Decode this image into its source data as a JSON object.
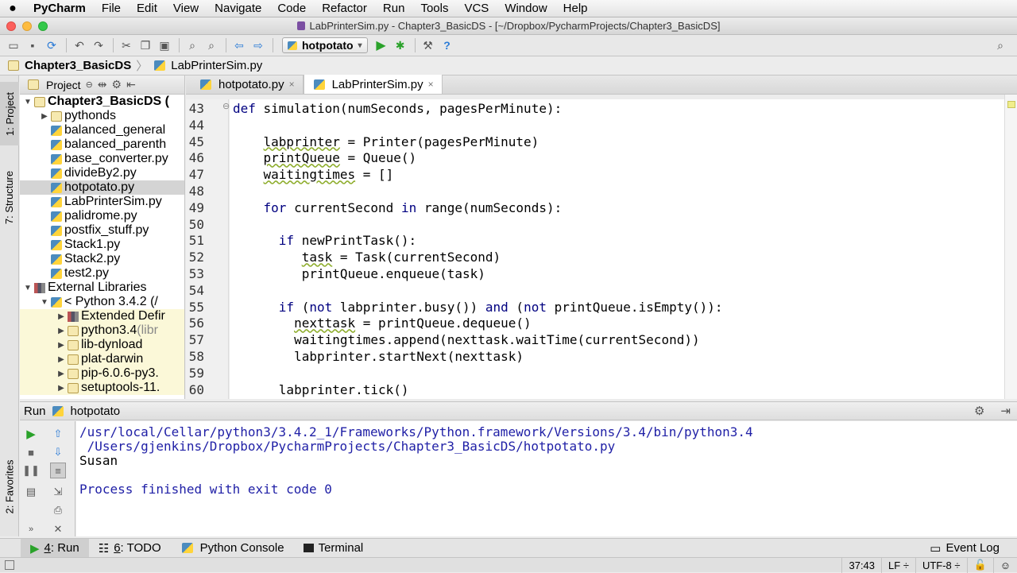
{
  "menubar": {
    "items": [
      "PyCharm",
      "File",
      "Edit",
      "View",
      "Navigate",
      "Code",
      "Refactor",
      "Run",
      "Tools",
      "VCS",
      "Window",
      "Help"
    ]
  },
  "window": {
    "title": "LabPrinterSim.py - Chapter3_BasicDS - [~/Dropbox/PycharmProjects/Chapter3_BasicDS]"
  },
  "toolbar": {
    "run_config": "hotpotato"
  },
  "breadcrumb": [
    "Chapter3_BasicDS",
    "LabPrinterSim.py"
  ],
  "leftstrip": {
    "project_tab": "1: Project",
    "structure_tab": "7: Structure",
    "favorites_tab": "2: Favorites"
  },
  "project": {
    "header": "Project",
    "tree": [
      {
        "label": "Chapter3_BasicDS (",
        "indent": 0,
        "tri": "▼",
        "icon": "folder",
        "bold": true
      },
      {
        "label": "pythonds",
        "indent": 1,
        "tri": "▶",
        "icon": "folder"
      },
      {
        "label": "balanced_general",
        "indent": 1,
        "tri": "",
        "icon": "py"
      },
      {
        "label": "balanced_parenth",
        "indent": 1,
        "tri": "",
        "icon": "py"
      },
      {
        "label": "base_converter.py",
        "indent": 1,
        "tri": "",
        "icon": "py"
      },
      {
        "label": "divideBy2.py",
        "indent": 1,
        "tri": "",
        "icon": "py"
      },
      {
        "label": "hotpotato.py",
        "indent": 1,
        "tri": "",
        "icon": "py",
        "selected": true
      },
      {
        "label": "LabPrinterSim.py",
        "indent": 1,
        "tri": "",
        "icon": "py"
      },
      {
        "label": "palidrome.py",
        "indent": 1,
        "tri": "",
        "icon": "py"
      },
      {
        "label": "postfix_stuff.py",
        "indent": 1,
        "tri": "",
        "icon": "py"
      },
      {
        "label": "Stack1.py",
        "indent": 1,
        "tri": "",
        "icon": "py"
      },
      {
        "label": "Stack2.py",
        "indent": 1,
        "tri": "",
        "icon": "py"
      },
      {
        "label": "test2.py",
        "indent": 1,
        "tri": "",
        "icon": "py"
      },
      {
        "label": "External Libraries",
        "indent": 0,
        "tri": "▼",
        "icon": "lib"
      },
      {
        "label": "< Python 3.4.2 (/",
        "indent": 1,
        "tri": "▼",
        "icon": "py"
      },
      {
        "label": "Extended Defir",
        "indent": 2,
        "tri": "▶",
        "icon": "lib",
        "ext": true
      },
      {
        "label": "python3.4",
        "suffix": " (libr",
        "indent": 2,
        "tri": "▶",
        "icon": "folder",
        "ext": true
      },
      {
        "label": "lib-dynload",
        "indent": 2,
        "tri": "▶",
        "icon": "folder",
        "ext": true
      },
      {
        "label": "plat-darwin",
        "indent": 2,
        "tri": "▶",
        "icon": "folder",
        "ext": true
      },
      {
        "label": "pip-6.0.6-py3.",
        "indent": 2,
        "tri": "▶",
        "icon": "folder",
        "ext": true
      },
      {
        "label": "setuptools-11.",
        "indent": 2,
        "tri": "▶",
        "icon": "folder",
        "ext": true
      }
    ]
  },
  "editor": {
    "tabs": [
      {
        "label": "hotpotato.py",
        "active": false
      },
      {
        "label": "LabPrinterSim.py",
        "active": true
      }
    ],
    "lines": [
      {
        "n": "43",
        "html": "<span class=\"kw\">def</span> simulation(numSeconds, pagesPerMinute):"
      },
      {
        "n": "44",
        "html": ""
      },
      {
        "n": "45",
        "html": "    <span class=\"sq\">labprinter</span> = Printer(pagesPerMinute)"
      },
      {
        "n": "46",
        "html": "    <span class=\"sq\">printQueue</span> = Queue()"
      },
      {
        "n": "47",
        "html": "    <span class=\"sq\">waitingtimes</span> = []"
      },
      {
        "n": "48",
        "html": ""
      },
      {
        "n": "49",
        "html": "    <span class=\"kw\">for</span> currentSecond <span class=\"kw\">in</span> range(numSeconds):"
      },
      {
        "n": "50",
        "html": ""
      },
      {
        "n": "51",
        "html": "      <span class=\"kw\">if</span> newPrintTask():"
      },
      {
        "n": "52",
        "html": "         <span class=\"sq\">task</span> = Task(currentSecond)"
      },
      {
        "n": "53",
        "html": "         printQueue.enqueue(task)"
      },
      {
        "n": "54",
        "html": ""
      },
      {
        "n": "55",
        "html": "      <span class=\"kw\">if</span> (<span class=\"kw\">not</span> labprinter.busy()) <span class=\"kw\">and</span> (<span class=\"kw\">not</span> printQueue.isEmpty()):"
      },
      {
        "n": "56",
        "html": "        <span class=\"sq\">nexttask</span> = printQueue.dequeue()"
      },
      {
        "n": "57",
        "html": "        waitingtimes.append(nexttask.waitTime(currentSecond))"
      },
      {
        "n": "58",
        "html": "        labprinter.startNext(nexttask)"
      },
      {
        "n": "59",
        "html": ""
      },
      {
        "n": "60",
        "html": "      labprinter.tick()"
      }
    ]
  },
  "run": {
    "label": "Run",
    "config": "hotpotato",
    "output": [
      {
        "text": "/usr/local/Cellar/python3/3.4.2_1/Frameworks/Python.framework/Versions/3.4/bin/python3.4",
        "cls": "cpath"
      },
      {
        "text": " /Users/gjenkins/Dropbox/PycharmProjects/Chapter3_BasicDS/hotpotato.py",
        "cls": "cpath"
      },
      {
        "text": "Susan",
        "cls": ""
      },
      {
        "text": "",
        "cls": ""
      },
      {
        "text": "Process finished with exit code 0",
        "cls": "cpath"
      }
    ]
  },
  "bottomtabs": {
    "run_num": "4",
    "run": ": Run",
    "todo_num": "6",
    "todo": ": TODO",
    "console": "Python Console",
    "terminal": "Terminal",
    "eventlog": "Event Log"
  },
  "status": {
    "position": "37:43",
    "line_sep": "LF ÷",
    "encoding": "UTF-8 ÷"
  },
  "colors": {
    "keyword": "#000080",
    "console_path": "#1f1fa6",
    "selection": "#d4d4d4",
    "external_bg": "#fbf8d8"
  }
}
